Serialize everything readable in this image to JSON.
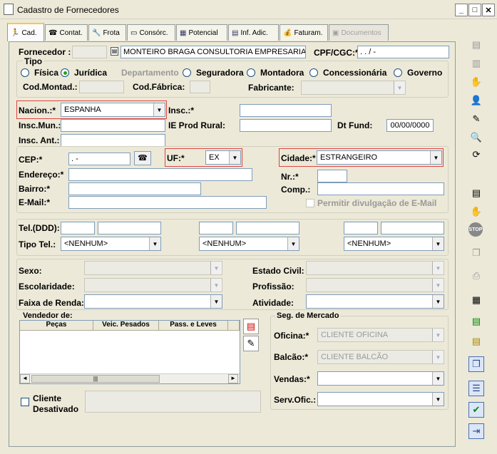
{
  "window": {
    "title": "Cadastro de Fornecedores",
    "min": "_",
    "max": "□",
    "close": "✕"
  },
  "tabs": [
    {
      "label": "Cad.",
      "icon": "🏃"
    },
    {
      "label": "Contat.",
      "icon": "☎"
    },
    {
      "label": "Frota",
      "icon": "🔧"
    },
    {
      "label": "Consórc.",
      "icon": "▭"
    },
    {
      "label": "Potencial",
      "icon": "▦"
    },
    {
      "label": "Inf. Adic.",
      "icon": "▤"
    },
    {
      "label": "Faturam.",
      "icon": "💰"
    },
    {
      "label": "Documentos",
      "icon": "▣"
    }
  ],
  "fornecedor": {
    "label": "Fornecedor :",
    "code": "",
    "name": "MONTEIRO BRAGA CONSULTORIA EMPRESARIAL LT",
    "cpf_label": "CPF/CGC:*",
    "cpf_value": " .  .  /   -"
  },
  "tipo": {
    "label": "Tipo",
    "options": [
      "Física",
      "Jurídica",
      "Departamento",
      "Seguradora",
      "Montadora",
      "Concessionária",
      "Governo"
    ],
    "cod_montad_label": "Cod.Montad.:",
    "cod_fabrica_label": "Cod.Fábrica:",
    "fabricante_label": "Fabricante:"
  },
  "nacion": {
    "label": "Nacion.:*",
    "value": "ESPANHA"
  },
  "insc": {
    "label": "Insc.:*",
    "mun_label": "Insc.Mun.:",
    "ie_label": "IE Prod Rural:",
    "dtfund_label": "Dt Fund:",
    "dtfund_value": "00/00/0000",
    "ant_label": "Insc. Ant.:"
  },
  "address": {
    "cep_label": "CEP:*",
    "cep_value": "  .   -",
    "uf_label": "UF:*",
    "uf_value": "EX",
    "cidade_label": "Cidade:*",
    "cidade_value": "ESTRANGEIRO",
    "endereco_label": "Endereço:*",
    "nr_label": "Nr.:*",
    "bairro_label": "Bairro:*",
    "comp_label": "Comp.:",
    "email_label": "E-Mail:*",
    "email_share_label": "Permitir divulgação de E-Mail"
  },
  "phones": {
    "tel_label": "Tel.(DDD):",
    "tipo_label": "Tipo Tel.:",
    "tipo_values": [
      "<NENHUM>",
      "<NENHUM>",
      "<NENHUM>"
    ]
  },
  "profile": {
    "sexo_label": "Sexo:",
    "escolaridade_label": "Escolaridade:",
    "faixa_label": "Faixa de Renda:",
    "civil_label": "Estado Civil:",
    "profissao_label": "Profissão:",
    "atividade_label": "Atividade:"
  },
  "vendedor": {
    "label": "Vendedor de:",
    "columns": [
      "Peças",
      "Veic. Pesados",
      "Pass. e Leves"
    ],
    "scroll_thumb": "|||"
  },
  "seg": {
    "label": "Seg. de Mercado",
    "oficina_label": "Oficina:*",
    "oficina_value": "CLIENTE OFICINA",
    "balcao_label": "Balcão:*",
    "balcao_value": "CLIENTE BALCÃO",
    "vendas_label": "Vendas:*",
    "servofic_label": "Serv.Ofic.:"
  },
  "desativado": {
    "label_line1": "Cliente",
    "label_line2": "Desativado"
  },
  "toolbar_icons": [
    "grid-add-icon",
    "grid-edit-icon",
    "hand-icon",
    "user-icon",
    "pencil-icon",
    "search-doc-icon",
    "refresh-icon",
    "document-icon",
    "hand-stop-icon",
    "stop-icon",
    "copy-icon",
    "print-icon",
    "report-icon",
    "green-doc-icon",
    "yellow-doc-icon",
    "window-icon",
    "list-icon",
    "save-check-icon",
    "exit-icon"
  ],
  "colors": {
    "red_frame": "#e0453f",
    "tab_accent": "#ffc83c"
  }
}
